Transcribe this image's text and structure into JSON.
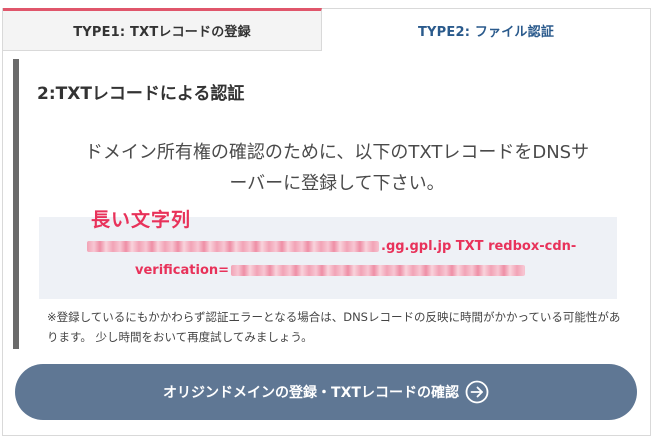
{
  "tabs": [
    {
      "label": "TYPE1: TXTレコードの登録",
      "active": true
    },
    {
      "label": "TYPE2: ファイル認証",
      "active": false
    }
  ],
  "section": {
    "title": "2:TXTレコードによる認証",
    "instruction_line1": "ドメイン所有権の確認のために、以下のTXTレコードをDNSサ",
    "instruction_line2": "ーバーに登録して下さい。"
  },
  "record": {
    "annotation": "長い文字列",
    "line1_suffix": ".gg.gpl.jp TXT redbox-cdn-",
    "line2_prefix": "verification="
  },
  "note": {
    "text": "※登録しているにもかかわらず認証エラーとなる場合は、DNSレコードの反映に時間がかかっている可能性があります。 少し時間をおいて再度試してみましょう。"
  },
  "button": {
    "label": "オリジンドメインの登録・TXTレコードの確認"
  },
  "colors": {
    "accent_tab": "#e0566b",
    "tab2_text": "#2a5a8c",
    "record_text": "#e8325a",
    "button_bg": "#5f7794",
    "record_bg": "#eef1f6"
  }
}
